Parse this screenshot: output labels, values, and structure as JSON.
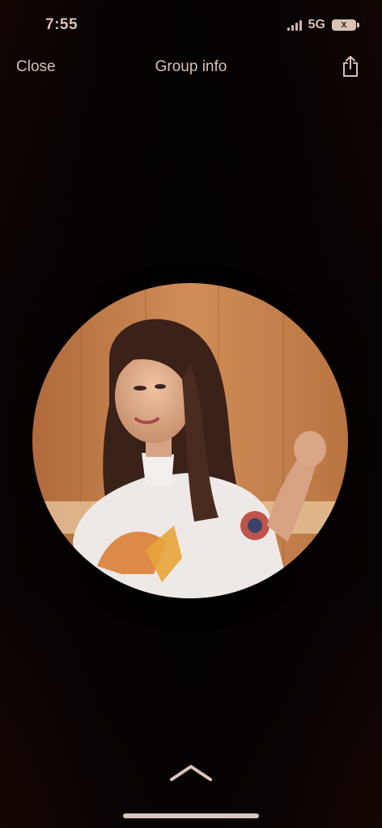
{
  "status_bar": {
    "time": "7:55",
    "network": "5G",
    "battery": "X"
  },
  "nav": {
    "close_label": "Close",
    "title": "Group info",
    "share_icon": "share-icon"
  },
  "content": {
    "photo_icon": "group-photo"
  },
  "controls": {
    "expand_icon": "chevron-up-icon"
  },
  "colors": {
    "background": "#1a0e0b",
    "text": "#d9c0b3",
    "accent": "#c98a58"
  }
}
